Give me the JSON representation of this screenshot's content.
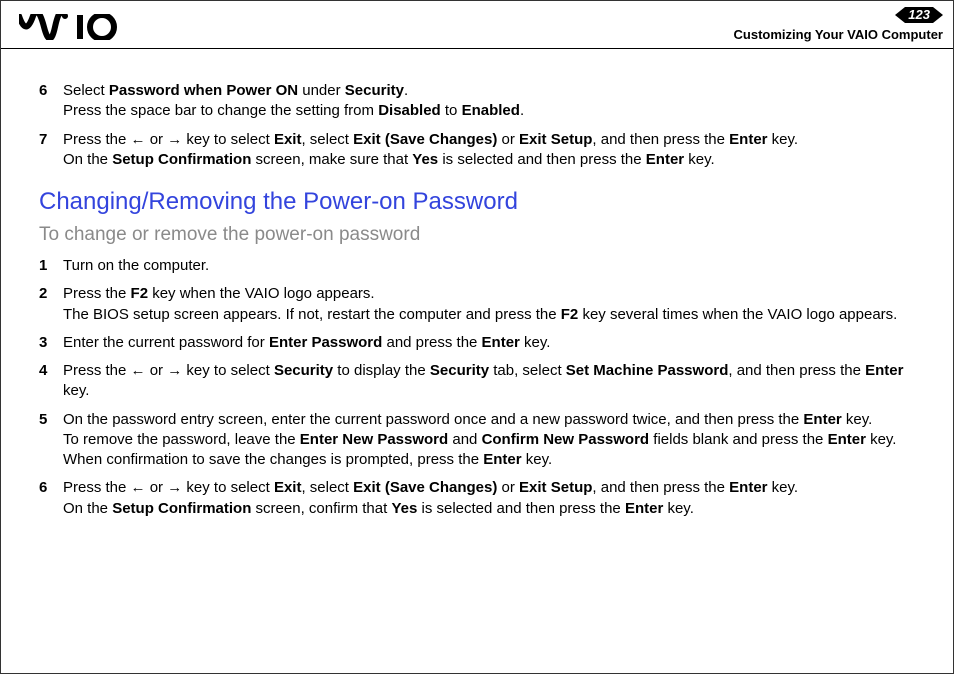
{
  "header": {
    "page_number": "123",
    "section_title": "Customizing Your VAIO Computer"
  },
  "top_steps": [
    {
      "num": "6",
      "lines": [
        "Select <b>Password when Power ON</b> under <b>Security</b>.",
        "Press the space bar to change the setting from <b>Disabled</b> to <b>Enabled</b>."
      ]
    },
    {
      "num": "7",
      "lines": [
        "Press the <span class='arrow'>&larr;</span> or <span class='arrow'>&rarr;</span> key to select <b>Exit</b>, select <b>Exit (Save Changes)</b> or <b>Exit Setup</b>, and then press the <b>Enter</b> key.",
        "On the <b>Setup Confirmation</b> screen, make sure that <b>Yes</b> is selected and then press the <b>Enter</b> key."
      ]
    }
  ],
  "section_heading": "Changing/Removing the Power-on Password",
  "section_subtitle": "To change or remove the power-on password",
  "steps": [
    {
      "num": "1",
      "lines": [
        "Turn on the computer."
      ]
    },
    {
      "num": "2",
      "lines": [
        "Press the <b>F2</b> key when the VAIO logo appears.",
        "The BIOS setup screen appears. If not, restart the computer and press the <b>F2</b> key several times when the VAIO logo appears."
      ]
    },
    {
      "num": "3",
      "lines": [
        "Enter the current password for <b>Enter Password</b> and press the <b>Enter</b> key."
      ]
    },
    {
      "num": "4",
      "lines": [
        "Press the <span class='arrow'>&larr;</span> or <span class='arrow'>&rarr;</span> key to select <b>Security</b> to display the <b>Security</b> tab, select <b>Set Machine Password</b>, and then press the <b>Enter</b> key."
      ]
    },
    {
      "num": "5",
      "lines": [
        "On the password entry screen, enter the current password once and a new password twice, and then press the <b>Enter</b> key.",
        "To remove the password, leave the <b>Enter New Password</b> and <b>Confirm New Password</b> fields blank and press the <b>Enter</b> key.",
        "When confirmation to save the changes is prompted, press the <b>Enter</b> key."
      ]
    },
    {
      "num": "6",
      "lines": [
        "Press the <span class='arrow'>&larr;</span> or <span class='arrow'>&rarr;</span> key to select <b>Exit</b>, select <b>Exit (Save Changes)</b> or <b>Exit Setup</b>, and then press the <b>Enter</b> key.",
        "On the <b>Setup Confirmation</b> screen, confirm that <b>Yes</b> is selected and then press the <b>Enter</b> key."
      ]
    }
  ]
}
